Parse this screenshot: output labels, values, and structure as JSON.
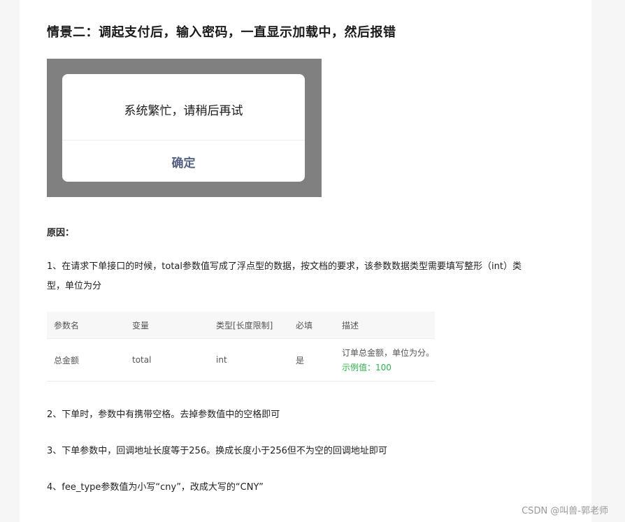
{
  "title": "情景二：调起支付后，输入密码，一直显示加载中，然后报错",
  "dialog": {
    "message": "系统繁忙，请稍后再试",
    "confirm_label": "确定"
  },
  "reason_label": "原因：",
  "reason1_line1": "1、在请求下单接口的时候，total参数值写成了浮点型的数据，按文档的要求，该参数数据类型需要填写整形（int）类",
  "reason1_line2": "型，单位为分",
  "table": {
    "headers": [
      "参数名",
      "变量",
      "类型[长度限制]",
      "必填",
      "描述"
    ],
    "row": {
      "name": "总金额",
      "variable": "total",
      "type": "int",
      "required": "是",
      "description": "订单总金额，单位为分。",
      "example": "示例值：100"
    }
  },
  "reason2": "2、下单时，参数中有携带空格。去掉参数值中的空格即可",
  "reason3": "3、下单参数中，回调地址长度等于256。换成长度小于256但不为空的回调地址即可",
  "reason4": "4、fee_type参数值为小写“cny”，改成大写的“CNY”",
  "watermark": "CSDN @叫兽-郭老师"
}
